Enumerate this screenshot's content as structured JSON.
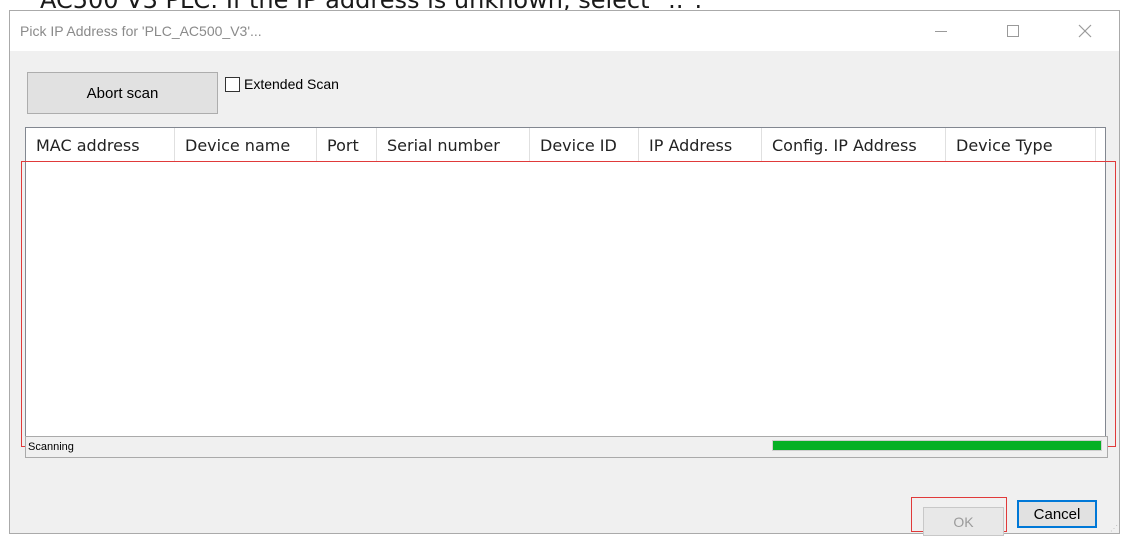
{
  "context": {
    "cut_text": "AC500 V3 PLC: If the IP address is unknown, select \"..\"."
  },
  "window": {
    "title": "Pick IP Address for 'PLC_AC500_V3'..."
  },
  "toolbar": {
    "abort_label": "Abort scan",
    "extended_scan_label": "Extended Scan",
    "extended_scan_checked": false
  },
  "table": {
    "columns": [
      "MAC address",
      "Device name",
      "Port",
      "Serial number",
      "Device ID",
      "IP Address",
      "Config. IP Address",
      "Device Type"
    ],
    "rows": []
  },
  "status": {
    "text": "Scanning",
    "progress": 1.0,
    "progress_color": "#06b025"
  },
  "buttons": {
    "ok_label": "OK",
    "cancel_label": "Cancel"
  },
  "colors": {
    "highlight": "#e03a3a",
    "focus_border": "#0078d7"
  }
}
